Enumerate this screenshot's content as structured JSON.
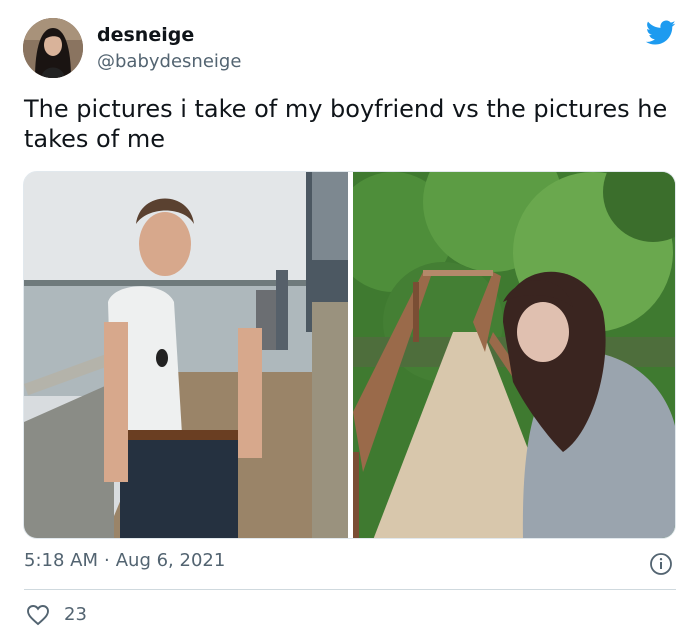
{
  "tweet": {
    "display_name": "desneige",
    "handle": "@babydesneige",
    "text": "The pictures i take of my boyfriend vs the pictures he takes of me",
    "time": "5:18 AM",
    "separator": "·",
    "date": "Aug 6, 2021",
    "like_count": "23"
  },
  "icons": {
    "brand": "twitter-bird-icon",
    "info": "info-icon",
    "like": "heart-icon"
  },
  "colors": {
    "brand_blue": "#1d9bf0",
    "text_primary": "#0f1419",
    "text_secondary": "#536471",
    "divider": "#cfd9de"
  }
}
